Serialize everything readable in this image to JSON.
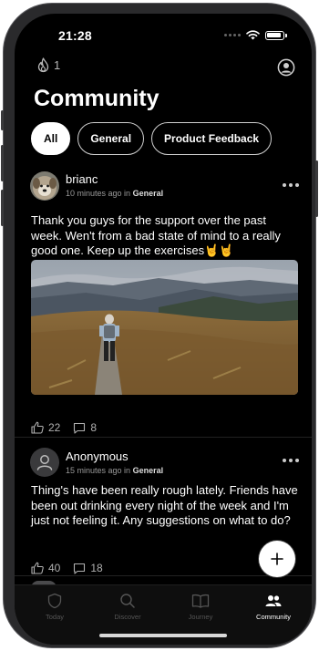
{
  "status": {
    "time": "21:28"
  },
  "header": {
    "streak_count": "1",
    "title": "Community"
  },
  "filters": [
    {
      "label": "All",
      "active": true
    },
    {
      "label": "General",
      "active": false
    },
    {
      "label": "Product Feedback",
      "active": false
    }
  ],
  "posts": [
    {
      "author": "brianc",
      "time_ago": "10 minutes ago in",
      "category": "General",
      "text": "Thank you guys for the support over the past week. Wen't from a bad state of mind to a really good one. Keep up the exercises🤘🤘",
      "likes": "22",
      "comments": "8"
    },
    {
      "author": "Anonymous",
      "time_ago": "15 minutes ago in",
      "category": "General",
      "text": "Thing's have been really rough lately. Friends have been out drinking every night of the week and I'm just not feeling it. Any suggestions on what to do?",
      "likes": "40",
      "comments": "18"
    }
  ],
  "tabs": [
    {
      "label": "Today",
      "icon": "shield-icon"
    },
    {
      "label": "Discover",
      "icon": "search-icon"
    },
    {
      "label": "Journey",
      "icon": "book-icon"
    },
    {
      "label": "Community",
      "icon": "people-icon",
      "active": true
    }
  ],
  "colors": {
    "background": "#000000",
    "accent": "#ffffff",
    "muted": "#999999"
  }
}
